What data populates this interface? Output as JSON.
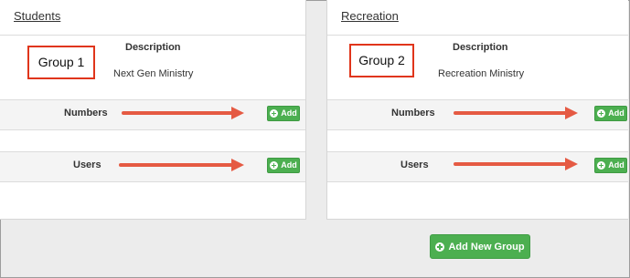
{
  "groups": [
    {
      "title": "Students",
      "description_header": "Description",
      "description": "Next Gen Ministry",
      "callout": "Group 1",
      "numbers_label": "Numbers",
      "users_label": "Users",
      "add_label": "Add"
    },
    {
      "title": "Recreation",
      "description_header": "Description",
      "description": "Recreation Ministry",
      "callout": "Group 2",
      "numbers_label": "Numbers",
      "users_label": "Users",
      "add_label": "Add"
    }
  ],
  "add_new_group_label": "Add New Group",
  "icons": {
    "add": "plus-circle-icon",
    "annotation": "arrow-right-icon"
  },
  "colors": {
    "button_green": "#4caf50",
    "annotation_red": "#e0351b",
    "arrow_red": "#e55a43"
  }
}
